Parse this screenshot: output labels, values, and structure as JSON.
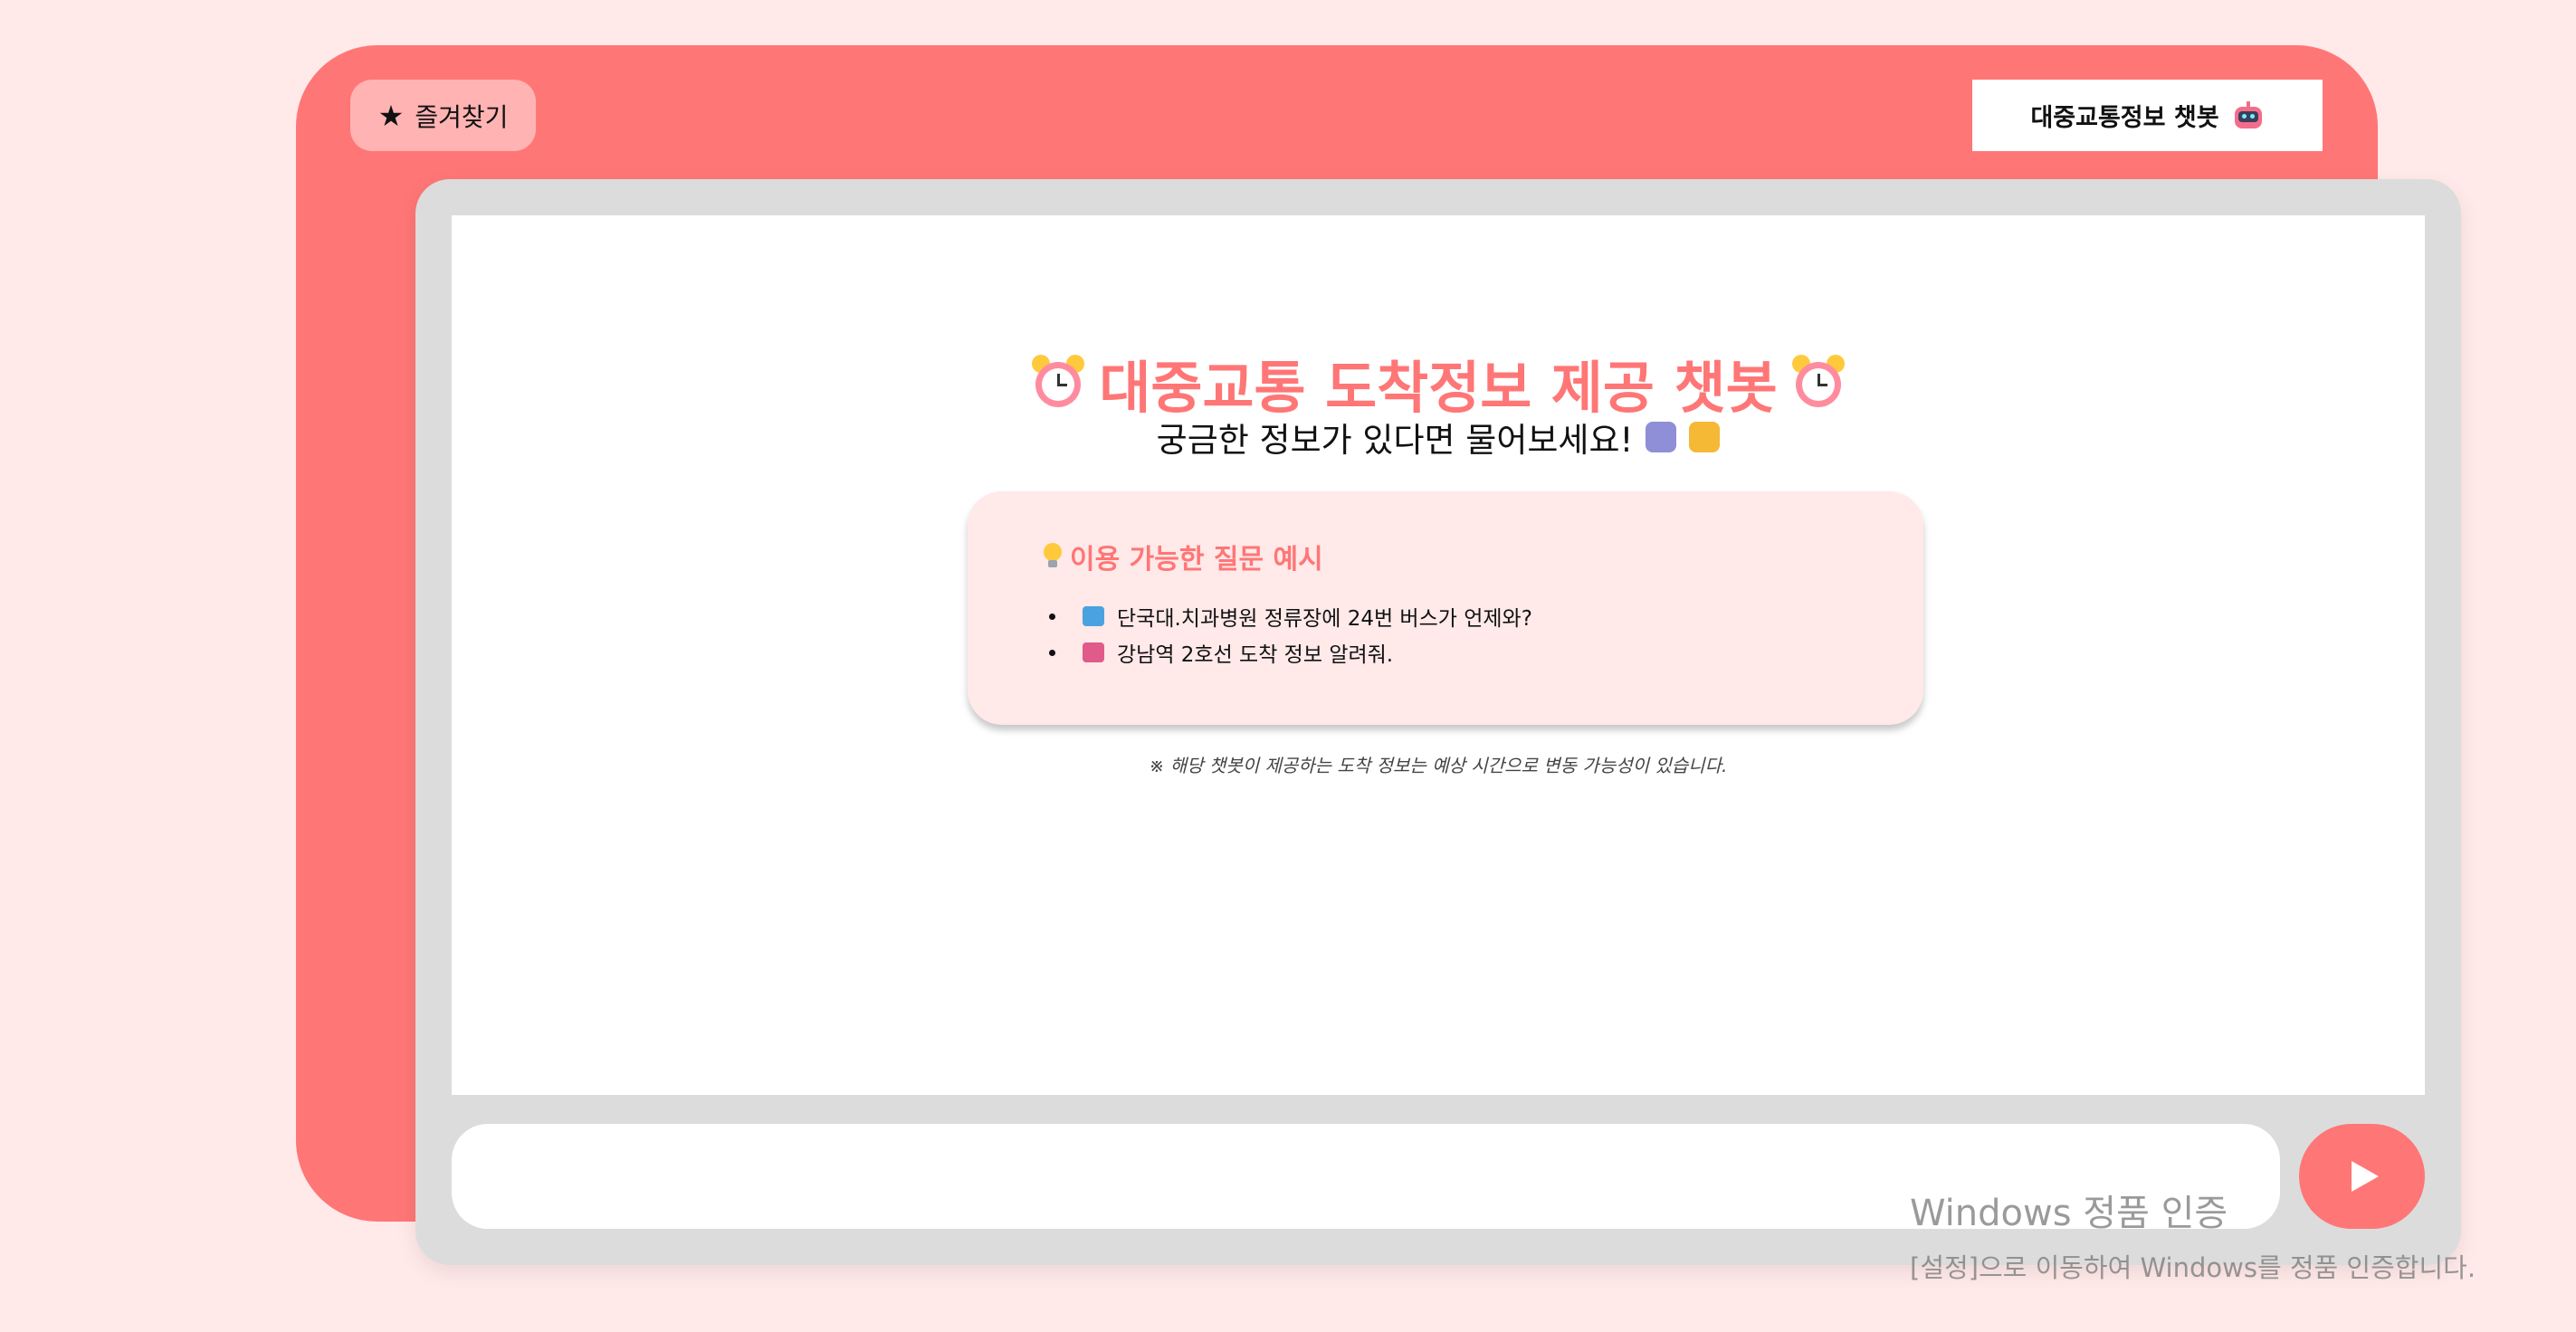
{
  "toolbar": {
    "favorites_icon": "star-icon",
    "favorites_label": "즐겨찾기",
    "app_title": "대중교통정보 챗봇",
    "app_title_icon": "robot-icon"
  },
  "chat": {
    "heading": "대중교통 도착정보 제공 챗봇",
    "heading_icon": "alarm-clock-icon",
    "subheading": "궁금한 정보가 있다면 물어보세요!",
    "subheading_icons": [
      "metro-icon",
      "bus-icon"
    ],
    "examples": {
      "icon": "light-bulb-icon",
      "title": "이용 가능한 질문 예시",
      "items": [
        {
          "icon": "bus-icon",
          "text": "단국대.치과병원 정류장에 24번 버스가 언제와?"
        },
        {
          "icon": "tram-icon",
          "text": "강남역 2호선 도착 정보 알려줘."
        }
      ]
    },
    "disclaimer": "※ 해당 챗봇이 제공하는 도착 정보는 예상 시간으로 변동 가능성이 있습니다."
  },
  "input": {
    "value": "",
    "placeholder": ""
  },
  "send_button_icon": "play-icon",
  "watermark": {
    "line1": "Windows 정품 인증",
    "line2": "[설정]으로 이동하여 Windows를 정품 인증합니다."
  },
  "colors": {
    "accent": "#ff7676",
    "background": "#ffe9e9",
    "frame": "#dcdcdc",
    "favorites_button": "#ffb3b3"
  }
}
